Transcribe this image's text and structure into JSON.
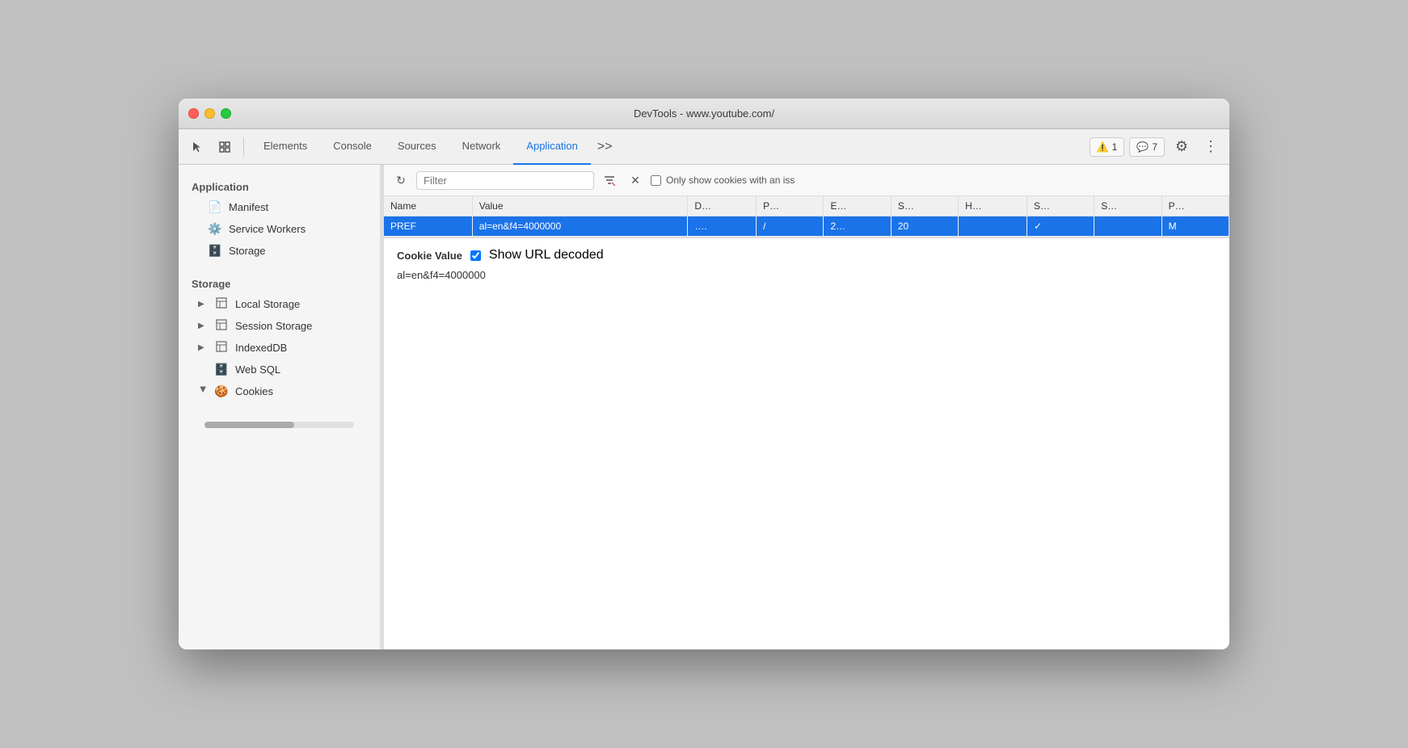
{
  "window": {
    "title": "DevTools - www.youtube.com/"
  },
  "toolbar": {
    "tabs": [
      {
        "id": "elements",
        "label": "Elements",
        "active": false
      },
      {
        "id": "console",
        "label": "Console",
        "active": false
      },
      {
        "id": "sources",
        "label": "Sources",
        "active": false
      },
      {
        "id": "network",
        "label": "Network",
        "active": false
      },
      {
        "id": "application",
        "label": "Application",
        "active": true
      }
    ],
    "more_label": ">>",
    "warning_count": "1",
    "chat_count": "7"
  },
  "sidebar": {
    "application_section": "Application",
    "items": [
      {
        "id": "manifest",
        "label": "Manifest",
        "icon": "📄"
      },
      {
        "id": "service-workers",
        "label": "Service Workers",
        "icon": "⚙️"
      },
      {
        "id": "storage",
        "label": "Storage",
        "icon": "🗄️"
      }
    ],
    "storage_section": "Storage",
    "storage_items": [
      {
        "id": "local-storage",
        "label": "Local Storage",
        "icon": "▦",
        "arrow": "▶"
      },
      {
        "id": "session-storage",
        "label": "Session Storage",
        "icon": "▦",
        "arrow": "▶"
      },
      {
        "id": "indexeddb",
        "label": "IndexedDB",
        "icon": "▦",
        "arrow": "▶"
      },
      {
        "id": "web-sql",
        "label": "Web SQL",
        "icon": "🗄️"
      },
      {
        "id": "cookies",
        "label": "Cookies",
        "icon": "🍪",
        "arrow": "▼"
      }
    ]
  },
  "cookie_panel": {
    "filter_placeholder": "Filter",
    "show_url_decoded_label": "Show URL decoded",
    "only_show_label": "Only show cookies with an iss",
    "table": {
      "columns": [
        "Name",
        "Value",
        "D…",
        "P…",
        "E…",
        "S…",
        "H…",
        "S…",
        "S…",
        "P…"
      ],
      "rows": [
        {
          "name": "PREF",
          "value": "al=en&f4=4000000",
          "d": "….",
          "p": "/",
          "e": "2…",
          "s": "20",
          "h": "",
          "s2": "✓",
          "s3": "",
          "p2": "M",
          "selected": true
        }
      ]
    },
    "cookie_value_label": "Cookie Value",
    "cookie_value": "al=en&f4=4000000"
  }
}
